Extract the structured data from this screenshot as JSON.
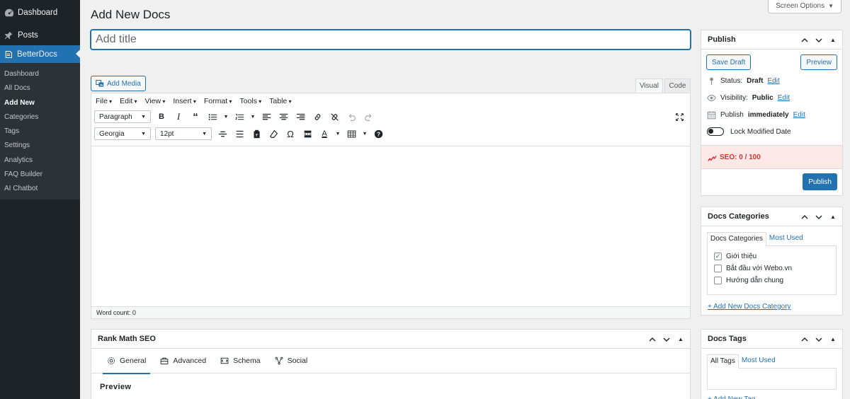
{
  "sidebar": {
    "dashboard_label": "Dashboard",
    "posts_label": "Posts",
    "betterdocs_label": "BetterDocs",
    "submenu": [
      {
        "label": "Dashboard"
      },
      {
        "label": "All Docs"
      },
      {
        "label": "Add New"
      },
      {
        "label": "Categories"
      },
      {
        "label": "Tags"
      },
      {
        "label": "Settings"
      },
      {
        "label": "Analytics"
      },
      {
        "label": "FAQ Builder"
      },
      {
        "label": "AI Chatbot"
      }
    ],
    "current_item": "Add New"
  },
  "header": {
    "title": "Add New Docs",
    "screen_options": "Screen Options"
  },
  "title_input": {
    "value": "",
    "placeholder": "Add title"
  },
  "editor": {
    "add_media_label": "Add Media",
    "tab_visual": "Visual",
    "tab_code": "Code",
    "menus": [
      "File",
      "Edit",
      "View",
      "Insert",
      "Format",
      "Tools",
      "Table"
    ],
    "format_select": "Paragraph",
    "font_select": "Georgia",
    "size_select": "12pt",
    "word_count": "Word count: 0"
  },
  "rankmath": {
    "title": "Rank Math SEO",
    "tabs": [
      {
        "label": "General"
      },
      {
        "label": "Advanced"
      },
      {
        "label": "Schema"
      },
      {
        "label": "Social"
      }
    ],
    "active_tab": "General",
    "preview_label": "Preview"
  },
  "publish": {
    "title": "Publish",
    "save_draft": "Save Draft",
    "preview": "Preview",
    "status_label": "Status:",
    "status_value": "Draft",
    "visibility_label": "Visibility:",
    "visibility_value": "Public",
    "publish_label": "Publish",
    "publish_value": "immediately",
    "edit": "Edit",
    "lock_modified": "Lock Modified Date",
    "lock_enabled": false,
    "seo_score": "SEO: 0 / 100",
    "publish_button": "Publish"
  },
  "categories": {
    "title": "Docs Categories",
    "tab_all": "Docs Categories",
    "tab_used": "Most Used",
    "items": [
      {
        "label": "Giới thiệu",
        "checked": true
      },
      {
        "label": "Bắt đầu với Webo.vn",
        "checked": false
      },
      {
        "label": "Hướng dẫn chung",
        "checked": false
      }
    ],
    "add_new": "+ Add New Docs Category"
  },
  "tags": {
    "title": "Docs Tags",
    "tab_all": "All Tags",
    "tab_used": "Most Used",
    "add_new": "+ Add New Tag"
  },
  "colors": {
    "sidebar_bg": "#1d2327",
    "accent": "#2271b1",
    "seo_bad": "#dc3232"
  }
}
